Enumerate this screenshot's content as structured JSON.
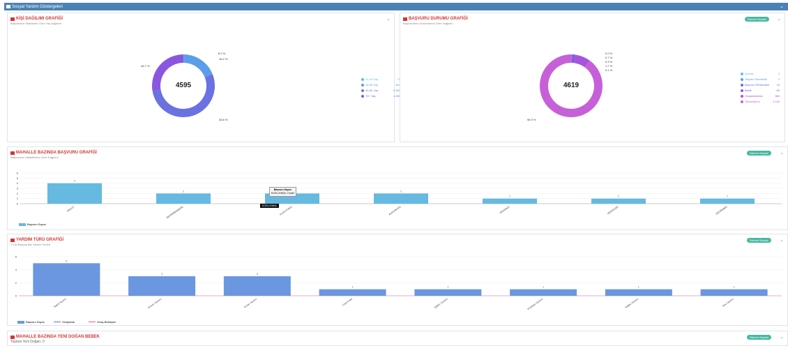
{
  "header": {
    "title": "Sosyal Yardım Göstergeleri"
  },
  "period_button": "Dönem Seçiniz",
  "age_panel": {
    "title": "KİŞİ DAĞILIMI GRAFİĞİ",
    "subtitle": "Başvuranın Statüsüne Göre Yaş Dağılımı",
    "total": "4595",
    "pct_labels": [
      "8.2 %",
      "16.2 %",
      "46.7 %",
      "28.8 %"
    ],
    "legend": [
      {
        "label": "01-18 Yaş",
        "value": "10",
        "color": "#5dbde8"
      },
      {
        "label": "18-35 Yaş",
        "value": "863",
        "color": "#5b9de8"
      },
      {
        "label": "40-60 Yaş",
        "value": "2.453",
        "color": "#6a71e0"
      },
      {
        "label": "70+ Yaş",
        "value": "1.269",
        "color": "#8a56e0"
      }
    ]
  },
  "status_panel": {
    "title": "BAŞVURU DURUMU GRAFİĞİ",
    "subtitle": "Başvuruların Durumlarına Göre Dağılımı",
    "total": "4619",
    "pct_labels": [
      "0.0 %",
      "0.7 %",
      "0.3 %",
      "1.7 %",
      "0.1 %",
      "96.9 %"
    ],
    "legend": [
      {
        "label": "Askıda",
        "value": "3",
        "color": "#5dbde8"
      },
      {
        "label": "Tespite Gönderildi",
        "value": "3",
        "color": "#5b9de8"
      },
      {
        "label": "Başvuru Reddedildi",
        "value": "15",
        "color": "#6a71e0"
      },
      {
        "label": "Bekle",
        "value": "83",
        "color": "#8a56e0"
      },
      {
        "label": "Onaylandıktan",
        "value": "360",
        "color": "#a653dd"
      },
      {
        "label": "Tamamlandı",
        "value": "4.155",
        "color": "#c660d8"
      }
    ]
  },
  "neighborhood_panel": {
    "title": "MAHALLE BAZINDA BAŞVURU GRAFİĞİ",
    "subtitle": "Başvuranın Mahallesine Göre Dağılımı",
    "legend_label": "Başvuru Sayısı",
    "tooltip_title": "Başvuru Sayısı",
    "tooltip_value": "KOZLUYAKA: 2 Adet",
    "tooltip_black": "KOZLUYAKA"
  },
  "aid_panel": {
    "title": "YARDIM TÜRÜ GRAFİĞİ",
    "subtitle": "Yıl İçi Başvurulan Yardım Türleri",
    "legend": [
      "Başvuru Sayısı",
      "Onaylandı",
      "Onay Bekleyen"
    ]
  },
  "baby_panel": {
    "title": "MAHALLE BAZINDA YENİ DOĞAN BEBEK",
    "subtitle": "Toplam Yeni Doğan: 0"
  },
  "chart_data": [
    {
      "type": "pie",
      "title": "KİŞİ DAĞILIMI GRAFİĞİ",
      "categories": [
        "01-18 Yaş",
        "18-35 Yaş",
        "40-60 Yaş",
        "70+ Yaş"
      ],
      "values": [
        10,
        863,
        2453,
        1269
      ],
      "colors": [
        "#5dbde8",
        "#5b9de8",
        "#6a71e0",
        "#8a56e0"
      ]
    },
    {
      "type": "pie",
      "title": "BAŞVURU DURUMU GRAFİĞİ",
      "categories": [
        "Askıda",
        "Tespite Gönderildi",
        "Başvuru Reddedildi",
        "Bekle",
        "Onaylandıktan",
        "Tamamlandı"
      ],
      "values": [
        3,
        3,
        15,
        83,
        360,
        4155
      ],
      "colors": [
        "#5dbde8",
        "#5b9de8",
        "#6a71e0",
        "#8a56e0",
        "#a653dd",
        "#c660d8"
      ]
    },
    {
      "type": "bar",
      "title": "MAHALLE BAZINDA BAŞVURU GRAFİĞİ",
      "categories": [
        "ARGUT",
        "DEĞİRMENDERE",
        "KOZLUYAKA",
        "ALACAKAYA",
        "BAĞDAĞI",
        "KEPEZLER",
        "DEĞİRMEN"
      ],
      "series": [
        {
          "name": "Başvuru Sayısı",
          "values": [
            4,
            2,
            2,
            2,
            1,
            1,
            1
          ]
        }
      ],
      "yticks": [
        0,
        1,
        2,
        3,
        4,
        5,
        6
      ],
      "ylim": [
        0,
        6
      ],
      "color": "#66b9e0"
    },
    {
      "type": "bar",
      "title": "YARDIM TÜRÜ GRAFİĞİ",
      "categories": [
        "Nakdi Yardım",
        "Kömür Yardımı",
        "Erzak Yardımı",
        "Gıda Kolisi",
        "Eğitim Yardımı",
        "Kırtasiye Yardımı",
        "Sağlık Yardımı",
        "Kira Yardımı"
      ],
      "series": [
        {
          "name": "Başvuru Sayısı",
          "values": [
            5,
            3,
            3,
            1,
            1,
            1,
            1,
            1
          ]
        },
        {
          "name": "Onaylandı",
          "values": [
            0,
            0,
            0,
            0,
            0,
            0,
            0,
            0
          ]
        },
        {
          "name": "Onay Bekleyen",
          "values": [
            0,
            0,
            0,
            0,
            0,
            0,
            0,
            0
          ]
        }
      ],
      "yticks": [
        0,
        2,
        4,
        6
      ],
      "ylim": [
        0,
        6
      ],
      "colors": [
        "#6a97e0",
        "#5b6ee8",
        "#e05a9a"
      ]
    }
  ]
}
